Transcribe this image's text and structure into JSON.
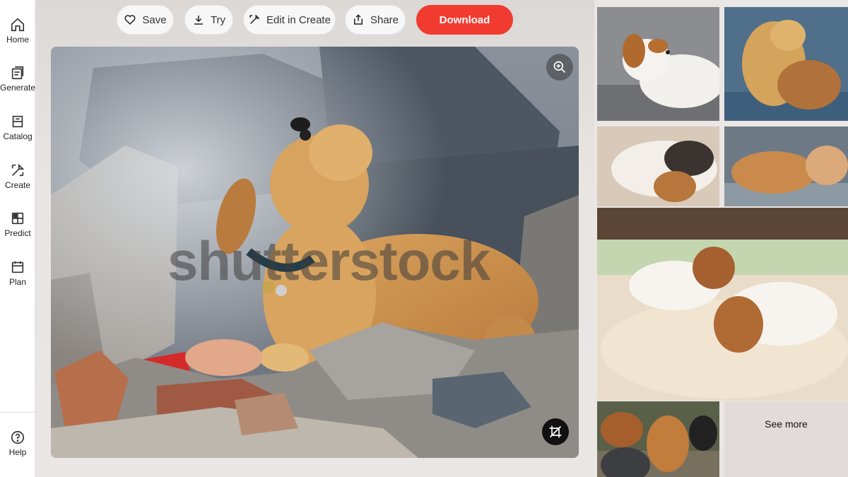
{
  "sidebar": {
    "items": [
      {
        "label": "Home",
        "icon": "home-icon"
      },
      {
        "label": "Generate",
        "icon": "generate-icon"
      },
      {
        "label": "Catalog",
        "icon": "catalog-icon"
      },
      {
        "label": "Create",
        "icon": "create-icon"
      },
      {
        "label": "Predict",
        "icon": "predict-icon"
      },
      {
        "label": "Plan",
        "icon": "plan-icon"
      }
    ],
    "help": {
      "label": "Help",
      "icon": "help-icon"
    }
  },
  "toolbar": {
    "save_label": "Save",
    "try_label": "Try",
    "edit_label": "Edit in Create",
    "share_label": "Share",
    "download_label": "Download"
  },
  "main_image": {
    "watermark": "shutterstock",
    "zoom_icon": "zoom-in-icon",
    "crop_icon": "crop-icon"
  },
  "related": {
    "see_more_label": "See more"
  },
  "colors": {
    "accent": "#f23b30",
    "sidebar_bg": "#ffffff"
  }
}
